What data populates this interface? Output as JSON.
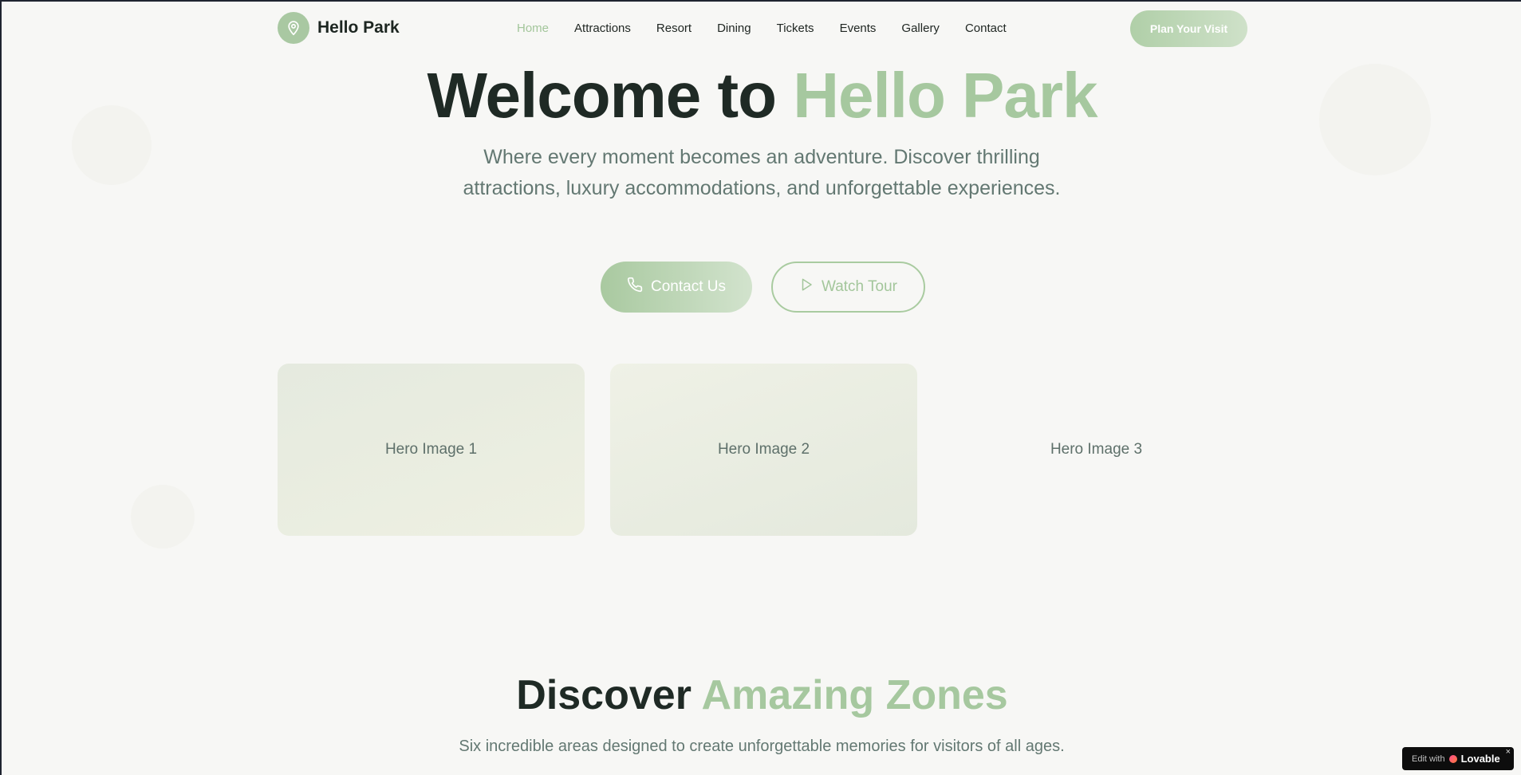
{
  "brand": {
    "name": "Hello Park",
    "icon": "map-pin-icon"
  },
  "nav": {
    "items": [
      {
        "label": "Home",
        "active": true
      },
      {
        "label": "Attractions"
      },
      {
        "label": "Resort"
      },
      {
        "label": "Dining"
      },
      {
        "label": "Tickets"
      },
      {
        "label": "Events"
      },
      {
        "label": "Gallery"
      },
      {
        "label": "Contact"
      }
    ],
    "cta": "Plan Your Visit"
  },
  "hero": {
    "title_prefix": "Welcome to ",
    "title_accent": "Hello Park",
    "subtitle": "Where every moment becomes an adventure. Discover thrilling attractions, luxury accommodations, and unforgettable experiences.",
    "contact_button": {
      "label": "Contact Us",
      "icon": "phone-icon"
    },
    "tour_button": {
      "label": "Watch Tour",
      "icon": "play-icon"
    },
    "images": [
      "Hero Image 1",
      "Hero Image 2",
      "Hero Image 3"
    ]
  },
  "zones": {
    "title_prefix": "Discover ",
    "title_accent": "Amazing Zones",
    "subtitle": "Six incredible areas designed to create unforgettable memories for visitors of all ages."
  },
  "badge": {
    "prefix": "Edit with",
    "brand": "Lovable",
    "close": "×"
  },
  "colors": {
    "accent": "#a6c89f",
    "text": "#1f2a25",
    "muted": "#637872",
    "background": "#f7f7f5"
  }
}
